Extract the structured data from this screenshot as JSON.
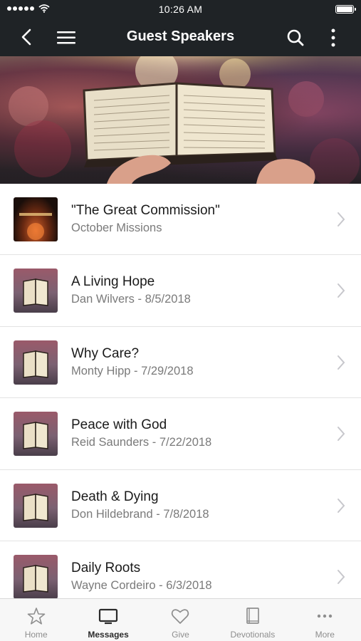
{
  "status_bar": {
    "time": "10:26 AM"
  },
  "nav": {
    "title": "Guest Speakers"
  },
  "list": {
    "items": [
      {
        "title": "\"The Great Commission\"",
        "subtitle": "October Missions",
        "thumb": "great-commission"
      },
      {
        "title": "A Living Hope",
        "subtitle": "Dan Wilvers - 8/5/2018",
        "thumb": "bible"
      },
      {
        "title": "Why Care?",
        "subtitle": "Monty Hipp - 7/29/2018",
        "thumb": "bible"
      },
      {
        "title": "Peace with God",
        "subtitle": "Reid Saunders - 7/22/2018",
        "thumb": "bible"
      },
      {
        "title": "Death & Dying",
        "subtitle": "Don Hildebrand - 7/8/2018",
        "thumb": "bible"
      },
      {
        "title": "Daily Roots",
        "subtitle": "Wayne Cordeiro - 6/3/2018",
        "thumb": "bible"
      }
    ]
  },
  "tabs": [
    {
      "label": "Home",
      "icon": "star-icon",
      "active": false
    },
    {
      "label": "Messages",
      "icon": "tv-icon",
      "active": true
    },
    {
      "label": "Give",
      "icon": "heart-icon",
      "active": false
    },
    {
      "label": "Devotionals",
      "icon": "book-icon",
      "active": false
    },
    {
      "label": "More",
      "icon": "more-horizontal-icon",
      "active": false
    }
  ]
}
